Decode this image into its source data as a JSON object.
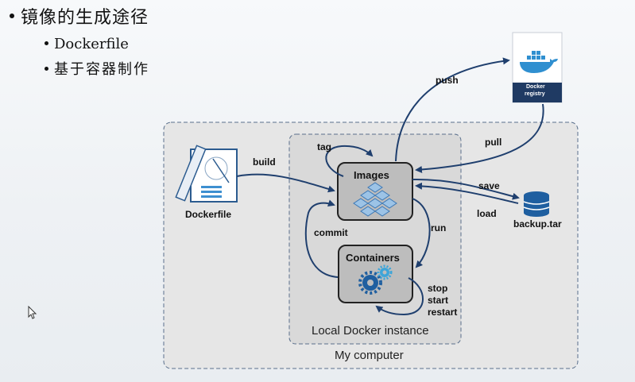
{
  "slide": {
    "title": "镜像的生成途径",
    "methods": [
      "Dockerfile",
      "基于容器制作"
    ]
  },
  "diagram": {
    "my_computer": "My computer",
    "local_instance": "Local Docker instance",
    "images": "Images",
    "containers": "Containers",
    "dockerfile": "Dockerfile",
    "registry_line1": "Docker",
    "registry_line2": "registry",
    "backup": "backup.tar",
    "edges": {
      "build": "build",
      "tag": "tag",
      "push": "push",
      "pull": "pull",
      "save": "save",
      "load": "load",
      "run": "run",
      "commit": "commit",
      "stop": "stop",
      "start": "start",
      "restart": "restart"
    }
  },
  "colors": {
    "arrow": "#1f3f6e",
    "box_fill": "#bdbdbd",
    "outer_fill": "#e9e9e9",
    "icon_blue": "#3d8fd0",
    "registry_bar": "#1f3a63"
  }
}
